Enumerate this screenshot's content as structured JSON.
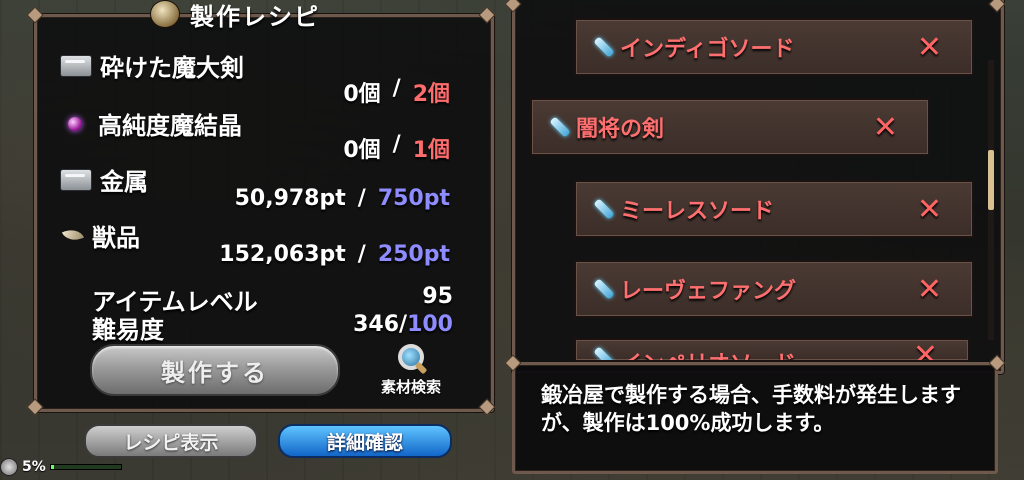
{
  "window": {
    "title": "製作レシピ"
  },
  "materials": [
    {
      "name": "砕けた魔大剣",
      "icon": "ingot-icon",
      "have": "0個",
      "sep": "/",
      "need": "2個",
      "need_color": "red"
    },
    {
      "name": "高純度魔結晶",
      "icon": "orb-icon",
      "have": "0個",
      "sep": "/",
      "need": "1個",
      "need_color": "red"
    },
    {
      "name": "金属",
      "icon": "ingot-icon",
      "have": "50,978pt",
      "sep": "/",
      "need": "750pt",
      "need_color": "blue"
    },
    {
      "name": "獣品",
      "icon": "fang-icon",
      "have": "152,063pt",
      "sep": "/",
      "need": "250pt",
      "need_color": "blue"
    }
  ],
  "stats": {
    "item_level_label": "アイテムレベル",
    "item_level_value": "95",
    "difficulty_label": "難易度",
    "difficulty_value": "346/",
    "difficulty_max": "100"
  },
  "buttons": {
    "craft": "製作する",
    "search": "素材検索",
    "show_recipe": "レシピ表示",
    "details": "詳細確認"
  },
  "recipes": [
    {
      "name": "インディゴソード",
      "remove": "✕"
    },
    {
      "name": "闇将の剣",
      "remove": "✕"
    },
    {
      "name": "ミーレスソード",
      "remove": "✕"
    },
    {
      "name": "レーヴェファング",
      "remove": "✕"
    },
    {
      "name": "インペリオソード",
      "remove": "✕"
    }
  ],
  "info": {
    "message": "鍛冶屋で製作する場合、手数料が発生しますが、製作は100%成功します。"
  },
  "status": {
    "percent": "5%",
    "fill_fraction": 0.05
  },
  "colors": {
    "need_red": "#ff6c6c",
    "need_blue": "#8f8cff",
    "recipe_name": "#ff6f6f",
    "panel_border": "#6e5a4c",
    "details_button": "#1266c8"
  }
}
